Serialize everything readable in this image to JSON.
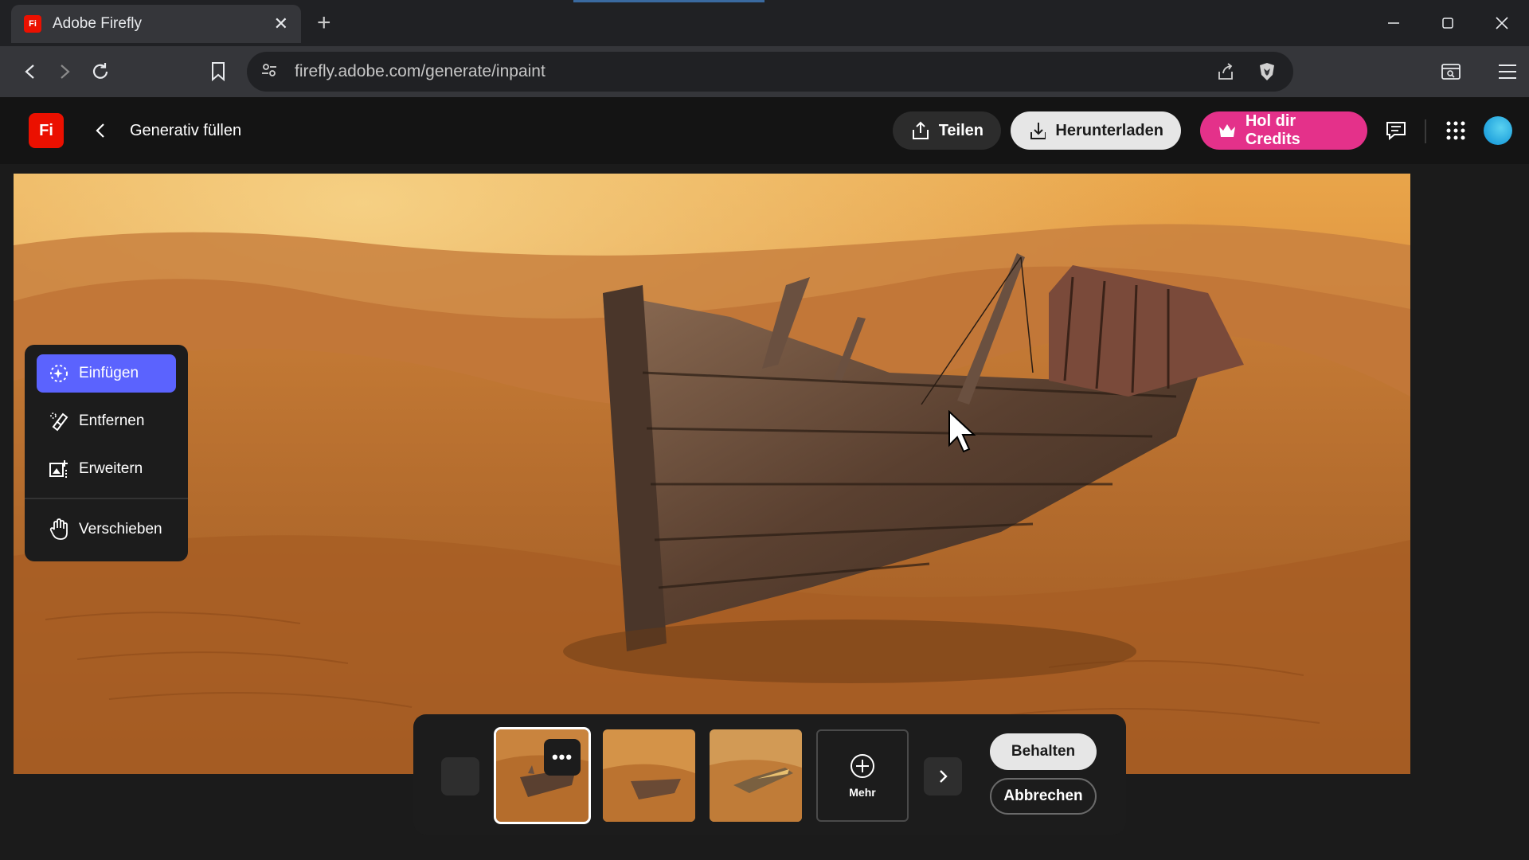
{
  "browser": {
    "tab_title": "Adobe Firefly",
    "tab_favicon_text": "Fi",
    "new_tab_symbol": "+",
    "tab_close_symbol": "✕",
    "url": "firefly.adobe.com/generate/inpaint"
  },
  "header": {
    "logo_text": "Fi",
    "page_title": "Generativ füllen",
    "share_label": "Teilen",
    "download_label": "Herunterladen",
    "credits_label": "Hol dir Credits"
  },
  "tools": {
    "insert_label": "Einfügen",
    "remove_label": "Entfernen",
    "expand_label": "Erweitern",
    "move_label": "Verschieben",
    "active_tool": "Einfügen"
  },
  "variations": {
    "more_menu_symbol": "•••",
    "more_label": "Mehr",
    "keep_label": "Behalten",
    "cancel_label": "Abbrechen",
    "selected_index": 0,
    "count": 3
  },
  "colors": {
    "accent_blue": "#5b63fe",
    "credits_pink": "#e4318a",
    "adobe_red": "#eb1000"
  }
}
